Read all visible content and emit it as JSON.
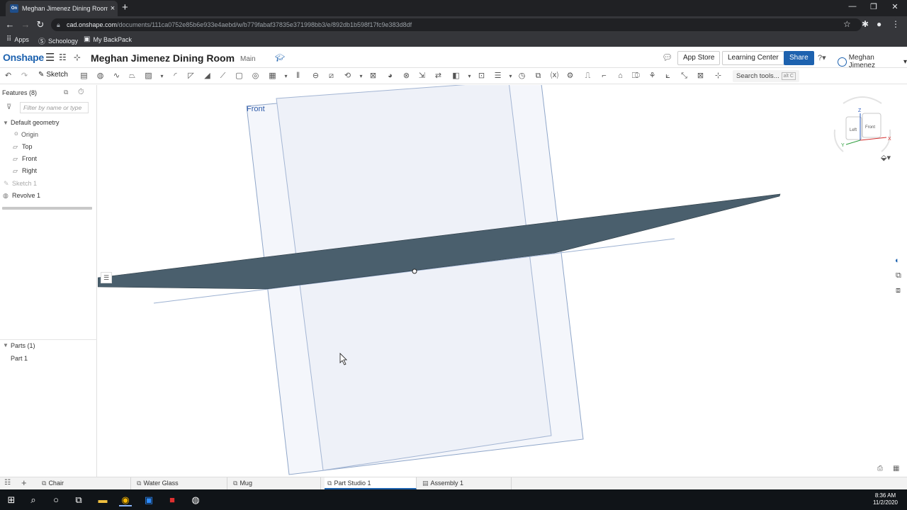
{
  "browser": {
    "tab_title": "Meghan Jimenez Dining Room |",
    "tab_favicon": "On",
    "url_host": "cad.onshape.com",
    "url_path": "/documents/111ca0752e85b6e933e4aebd/w/b779fabaf37835e371998bb3/e/892db1b598f17fc9e383d8df",
    "bookmarks": [
      "Apps",
      "Schoology",
      "My BackPack"
    ]
  },
  "header": {
    "logo": "Onshape",
    "document_name": "Meghan Jimenez Dining Room",
    "branch": "Main",
    "app_store": "App Store",
    "learning_center": "Learning Center",
    "share": "Share",
    "user": "Meghan Jimenez"
  },
  "toolbar": {
    "sketch_label": "Sketch",
    "search_placeholder": "Search tools...",
    "search_shortcut": "alt C"
  },
  "features": {
    "header": "Features (8)",
    "filter_placeholder": "Filter by name or type",
    "default_geometry": "Default geometry",
    "items": [
      "Origin",
      "Top",
      "Front",
      "Right"
    ],
    "sketch": "Sketch 1",
    "revolve": "Revolve 1",
    "parts_header": "Parts (1)",
    "parts": [
      "Part 1"
    ]
  },
  "viewport": {
    "plane_label": "Front",
    "viewcube": {
      "top": "Z",
      "left_face": "Left",
      "front_face": "Front",
      "x": "X",
      "y": "Y"
    },
    "part_color": "#4a5f6d",
    "plane_color": "#f4f6fb",
    "plane_edge_color": "#8fa6c9"
  },
  "tabs": [
    {
      "label": "Chair",
      "active": false
    },
    {
      "label": "Water Glass",
      "active": false
    },
    {
      "label": "Mug",
      "active": false
    },
    {
      "label": "Part Studio 1",
      "active": true
    },
    {
      "label": "Assembly 1",
      "active": false
    }
  ],
  "taskbar": {
    "time": "8:36 AM",
    "date": "11/2/2020"
  }
}
